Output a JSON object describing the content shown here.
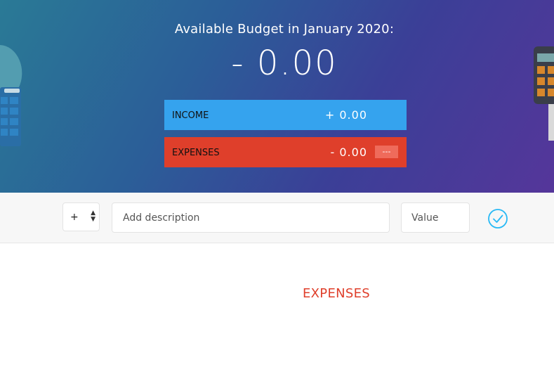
{
  "header": {
    "budget_title": "Available Budget in January 2020:",
    "budget_value": "- 0.00",
    "income": {
      "label": "INCOME",
      "value": "+ 0.00",
      "color": "#35a3ee"
    },
    "expenses": {
      "label": "EXPENSES",
      "value": "- 0.00",
      "percentage": "---",
      "color": "#df3f2b"
    }
  },
  "add_bar": {
    "type_select_value": "+",
    "description_placeholder": "Add description",
    "value_placeholder": "Value",
    "add_button_icon": "check-circle-icon",
    "accent_color": "#28b9f5"
  },
  "lists": {
    "expenses_title": "EXPENSES",
    "expenses_title_color": "#df3f2b"
  }
}
